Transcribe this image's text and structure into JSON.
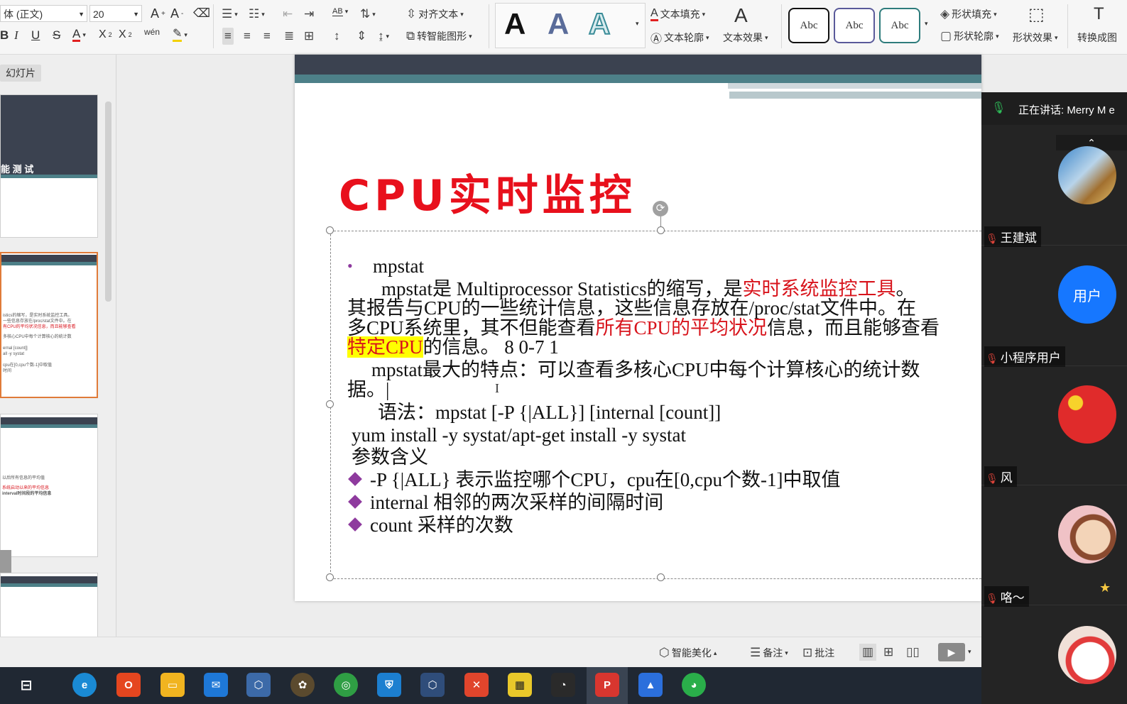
{
  "ribbon": {
    "font_name": "体 (正文)",
    "font_size": "20",
    "align_text": "对齐文本",
    "smart_shape": "转智能图形",
    "text_fill": "文本填充",
    "text_outline": "文本轮廓",
    "text_effect": "文本效果",
    "abc": "Abc",
    "shape_fill": "形状填充",
    "shape_outline": "形状轮廓",
    "shape_effect": "形状效果",
    "convert": "转换成图",
    "sub_label": "wén"
  },
  "left_panel": {
    "tab": "幻灯片",
    "thumb1_text": "能 测 试",
    "thumb2_lines": [
      "istics的缩写，是实时系统监控工具。",
      "一些信息存放在/proc/stat文件中。在",
      "有CPU的平均状况信息，而且能够查看",
      "多核心CPU中每个计算核心的统计数",
      "ernal [count]]",
      "all -y systat",
      "cpu在[0,cpu个数-1]中取值",
      "时间"
    ],
    "thumb3_lines": [
      "以后所有信息的平均值",
      "系统启动以来的平均信息",
      "interval时间段的平均信息"
    ]
  },
  "slide": {
    "title": "CPU实时监控",
    "bullet1": "mpstat",
    "p1_a": "mpstat是 Multiprocessor Statistics的缩写，是",
    "p1_red": "实时系统监控工具",
    "p1_end": "。",
    "p2": "其报告与CPU的一些统计信息，这些信息存放在/proc/stat文件中。在",
    "p3_a": "多CPU系统里，其不但能查看",
    "p3_red": "所有CPU的平均状况",
    "p3_b": "信息，而且能够查看",
    "p4_hl": "特定CPU",
    "p4_b": "的信息。 8  0-7  1",
    "p5": "mpstat最大的特点：可以查看多核心CPU中每个计算核心的统计数",
    "p6": "据。|",
    "syntax": "语法：mpstat [-P {|ALL}] [internal [count]]",
    "install": "yum install -y systat/apt-get install -y systat",
    "params": "参数含义",
    "opt1": "-P {|ALL} 表示监控哪个CPU，cpu在[0,cpu个数-1]中取值",
    "opt2": "internal 相邻的两次采样的间隔时间",
    "opt3": "count 采样的次数"
  },
  "status": {
    "beautify": "智能美化",
    "notes": "备注",
    "comment": "批注"
  },
  "meeting": {
    "speaking": "正在讲话: Merry M e",
    "participants": [
      "王建斌",
      "小程序用户",
      "风",
      "咯～"
    ],
    "user_avatar_text": "用户"
  },
  "colors": {
    "title_red": "#e8101c",
    "slide_dark": "#3b4250",
    "slide_teal": "#4d8088",
    "highlight": "#ffff00",
    "bullet_purple": "#8e3a9e"
  }
}
